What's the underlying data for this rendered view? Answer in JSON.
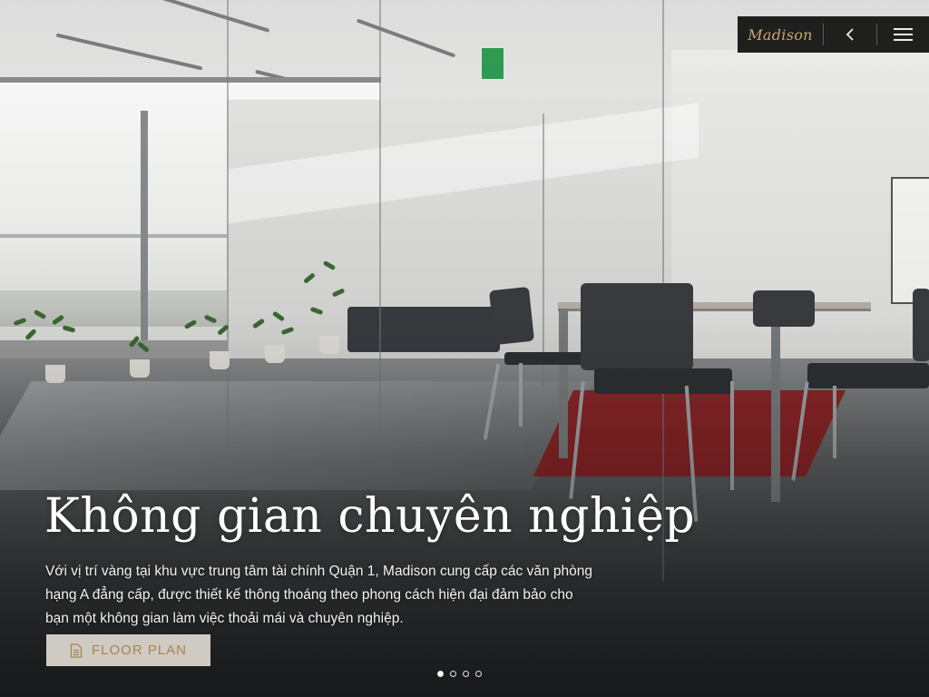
{
  "header": {
    "brand": "Madison",
    "back_icon": "chevron-left-icon",
    "menu_icon": "hamburger-menu-icon",
    "background_color": "#1f1f1e",
    "brand_color": "#c8a86e"
  },
  "hero": {
    "title": "Không gian chuyên nghiệp",
    "description": "Với vị trí vàng tại khu vực trung tâm tài chính Quận 1, Madison cung cấp các văn phòng hạng A đẳng cấp, được thiết kế thông thoáng theo phong cách hiện đại đảm bảo cho bạn một không gian làm việc thoải mái và chuyên nghiệp.",
    "button": {
      "label": "FLOOR PLAN",
      "icon": "document-icon",
      "background_color": "#cfcac2",
      "text_color": "#a38652"
    }
  },
  "carousel": {
    "total": 4,
    "active_index": 0
  }
}
